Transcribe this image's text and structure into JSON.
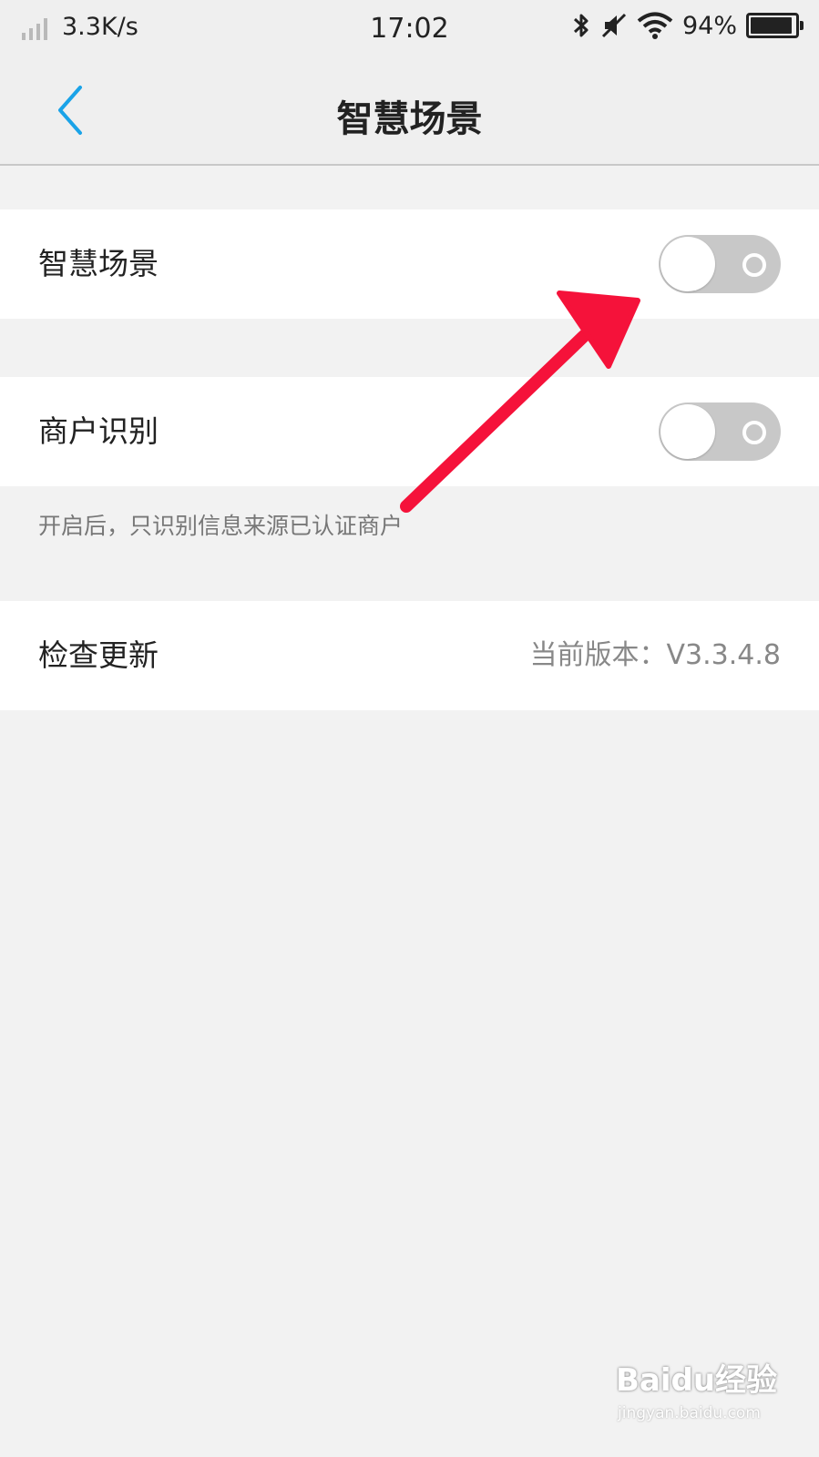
{
  "status_bar": {
    "network_speed": "3.3K/s",
    "time": "17:02",
    "battery_percent": "94%",
    "battery_level": 0.94
  },
  "header": {
    "title": "智慧场景"
  },
  "settings": {
    "smart_scene": {
      "label": "智慧场景",
      "enabled": false
    },
    "merchant_recognition": {
      "label": "商户识别",
      "enabled": false,
      "hint": "开启后，只识别信息来源已认证商户"
    },
    "check_update": {
      "label": "检查更新",
      "version_text": "当前版本：V3.3.4.8"
    }
  },
  "watermark": {
    "brand": "Baidu经验",
    "url": "jingyan.baidu.com"
  },
  "colors": {
    "accent": "#1aa3e8",
    "annotation_arrow": "#f5123a",
    "toggle_off": "#c8c8c8"
  }
}
